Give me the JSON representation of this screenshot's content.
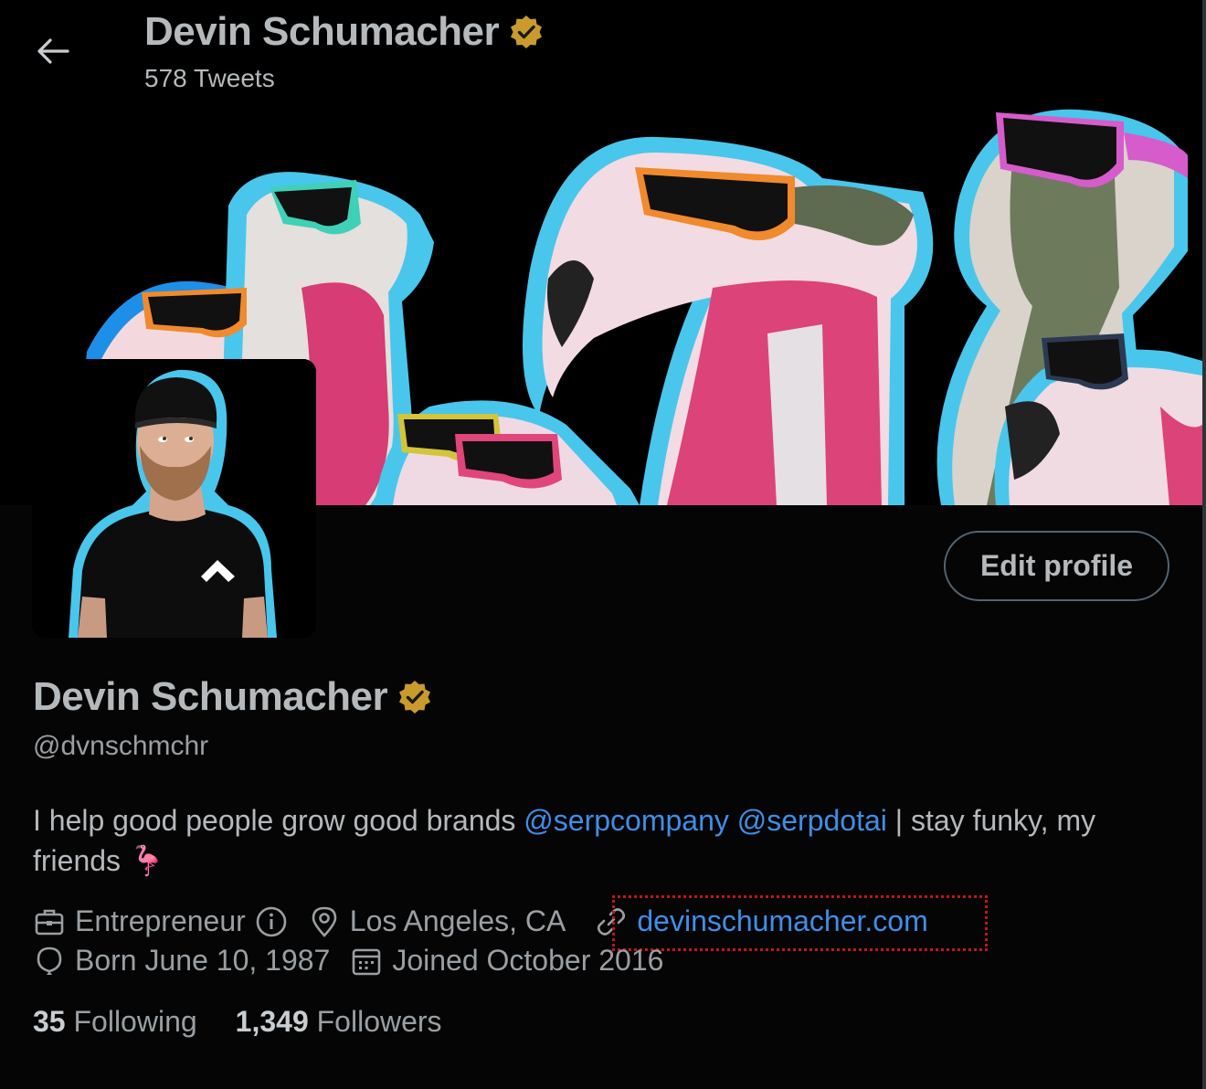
{
  "header": {
    "name": "Devin Schumacher",
    "tweets_count": "578 Tweets"
  },
  "profile": {
    "display_name": "Devin Schumacher",
    "handle": "@dvnschmchr",
    "edit_button": "Edit profile",
    "bio": {
      "text_1": "I help good people grow good brands ",
      "mention_1": "@serpcompany",
      "space": " ",
      "mention_2": "@serpdotai",
      "text_2": " | stay funky, my friends ",
      "emoji": "🦩"
    },
    "meta": {
      "profession": "Entrepreneur",
      "location": "Los Angeles, CA",
      "website": "devinschumacher.com",
      "birthday": "Born June 10, 1987",
      "joined": "Joined October 2016"
    },
    "stats": {
      "following_count": "35",
      "following_label": " Following",
      "followers_count": "1,349",
      "followers_label": " Followers"
    }
  },
  "colors": {
    "background": "#000000",
    "accent_link": "#3f8ee8",
    "verified_badge": "#c89b2c",
    "flamingo_pink": "#e0457b",
    "outline_blue": "#49c6ec"
  },
  "icons": {
    "back": "arrow-left-icon",
    "verified": "verified-badge-icon",
    "profession": "briefcase-icon",
    "info": "info-icon",
    "location": "location-pin-icon",
    "link": "link-icon",
    "birthday": "balloon-icon",
    "joined": "calendar-icon"
  }
}
